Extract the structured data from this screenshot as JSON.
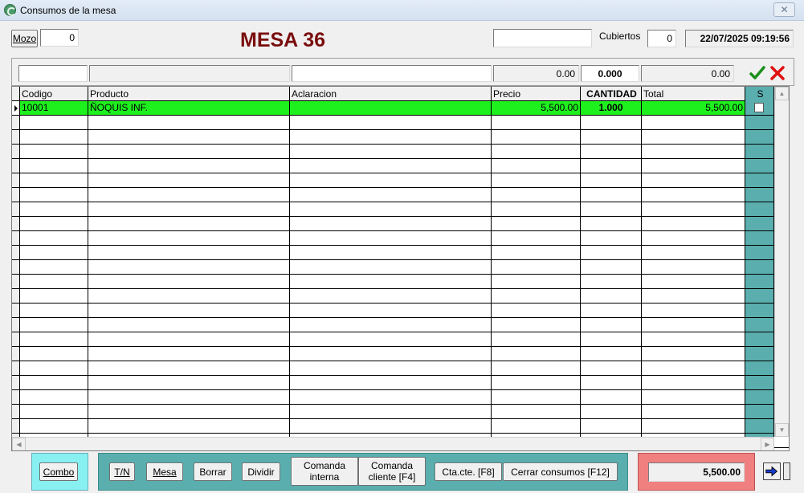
{
  "window": {
    "title": "Consumos de la mesa",
    "close_label": "✕"
  },
  "header": {
    "mozo_label": "Mozo",
    "mozo_value": "0",
    "mesa_title": "MESA 36",
    "search_value": "",
    "cubiertos_label": "Cubiertos",
    "cubiertos_value": "0",
    "datetime": "22/07/2025 09:19:56"
  },
  "entry_row": {
    "codigo": "",
    "producto": "",
    "aclaracion": "",
    "precio": "0.00",
    "cantidad": "0.000",
    "total": "0.00"
  },
  "grid": {
    "columns": [
      "Codigo",
      "Producto",
      "Aclaracion",
      "Precio",
      "CANTIDAD",
      "Total",
      "S"
    ],
    "rows": [
      {
        "codigo": "10001",
        "producto": "ÑOQUIS INF.",
        "aclaracion": "",
        "precio": "5,500.00",
        "cantidad": "1.000",
        "total": "5,500.00",
        "s": false
      }
    ]
  },
  "buttons": {
    "combo": "Combo",
    "tn": "T/N",
    "mesa": "Mesa",
    "borrar": "Borrar",
    "dividir": "Dividir",
    "comanda_interna_1": "Comanda",
    "comanda_interna_2": "interna",
    "comanda_cliente_1": "Comanda",
    "comanda_cliente_2": "cliente [F4]",
    "cta_cte": "Cta.cte. [F8]",
    "cerrar": "Cerrar consumos [F12]"
  },
  "footer": {
    "total": "5,500.00"
  },
  "colors": {
    "selected_row": "#1ef01e",
    "mesa_title": "#7a0d0d",
    "teal_panel": "#5aaeae",
    "combo_panel": "#88f0f0",
    "total_panel": "#f08080"
  },
  "icons": [
    "app-icon",
    "close-icon",
    "check-icon",
    "cancel-icon",
    "exit-icon"
  ]
}
